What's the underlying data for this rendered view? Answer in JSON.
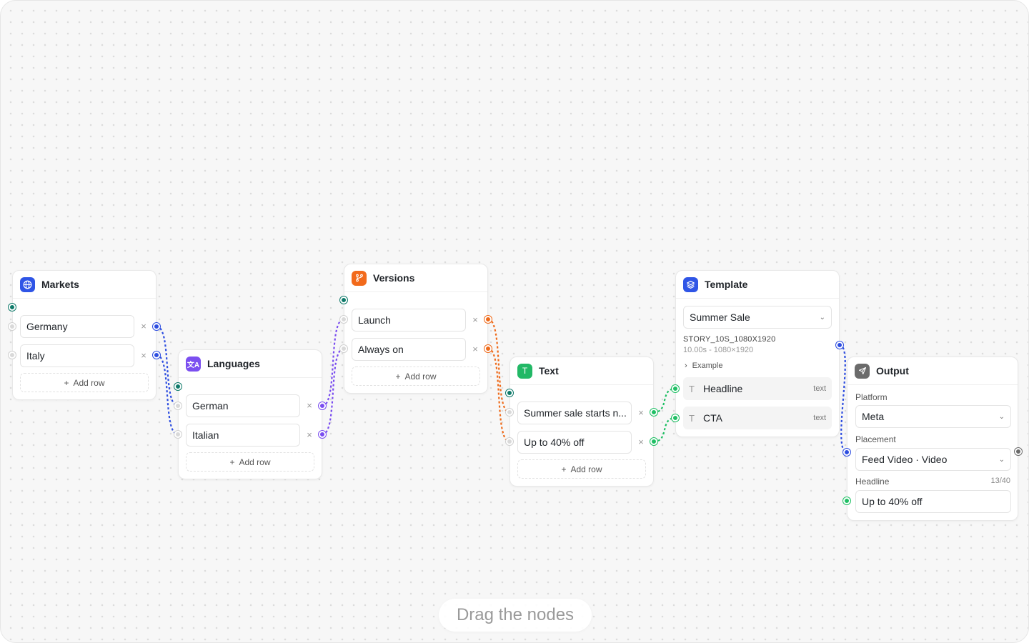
{
  "hint": "Drag the nodes",
  "add_row_label": "Add row",
  "markets": {
    "title": "Markets",
    "icon": "globe-icon",
    "accent": "#2f55e6",
    "rows": [
      "Germany",
      "Italy"
    ]
  },
  "languages": {
    "title": "Languages",
    "icon": "translate-icon",
    "accent": "#7b4ff0",
    "rows": [
      "German",
      "Italian"
    ]
  },
  "versions": {
    "title": "Versions",
    "icon": "branch-icon",
    "accent": "#f26a1b",
    "rows": [
      "Launch",
      "Always on"
    ]
  },
  "text": {
    "title": "Text",
    "icon": "text-icon",
    "accent": "#22b866",
    "icon_glyph": "T",
    "rows": [
      "Summer sale starts n...",
      "Up to 40% off"
    ]
  },
  "template": {
    "title": "Template",
    "icon": "layers-icon",
    "accent": "#2f55e6",
    "selected": "Summer Sale",
    "format_name": "STORY_10S_1080X1920",
    "format_meta": "10.00s - 1080×1920",
    "example_label": "Example",
    "variables": [
      {
        "name": "Headline",
        "type": "text"
      },
      {
        "name": "CTA",
        "type": "text"
      }
    ]
  },
  "output": {
    "title": "Output",
    "icon": "send-icon",
    "accent": "#6b6b6b",
    "platform_label": "Platform",
    "platform_value": "Meta",
    "placement_label": "Placement",
    "placement_value": "Feed Video · Video",
    "headline_label": "Headline",
    "headline_counter": "13/40",
    "headline_value": "Up to 40% off"
  },
  "colors": {
    "blue": "#2d4de0",
    "purple": "#7a4df0",
    "orange": "#ee6a1a",
    "green": "#1fbf64",
    "teal": "#0f7a6a"
  }
}
